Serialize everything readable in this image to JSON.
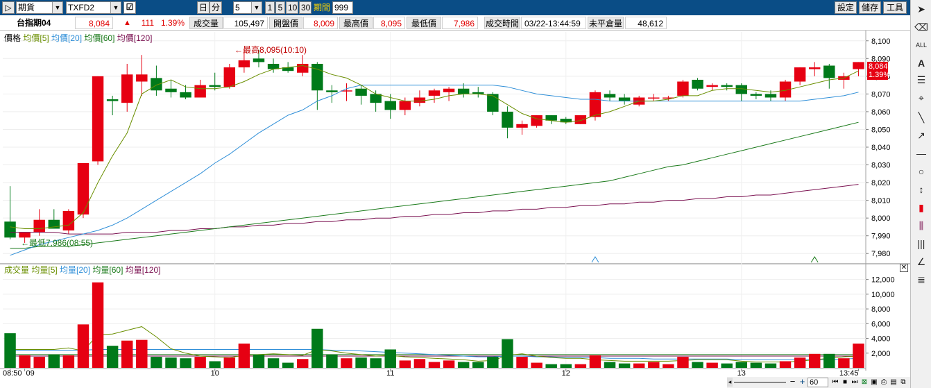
{
  "toolbar": {
    "play": "▷",
    "market": "期貨",
    "symbol": "TXFD2",
    "day_btn": "日",
    "minute_btn": "分",
    "interval": "5",
    "q1": "1",
    "q5": "5",
    "q10": "10",
    "q30": "30",
    "period_label": "期間",
    "period_value": "999",
    "settings": "設定",
    "save": "儲存",
    "tools": "工具"
  },
  "quote": {
    "name": "台指期04",
    "price": "8,084",
    "arrow": "▲",
    "change": "111",
    "pct": "1.39%",
    "vol_label": "成交量",
    "vol": "105,497",
    "open_label": "開盤價",
    "open": "8,009",
    "high_label": "最高價",
    "high": "8,095",
    "low_label": "最低價",
    "low": "7,986",
    "time_label": "成交時間",
    "time": "03/22-13:44:59",
    "oi_label": "未平倉量",
    "oi": "48,612"
  },
  "price_legend": {
    "main": "價格",
    "ma5": "均價[5]",
    "ma20": "均價[20]",
    "ma60": "均價[60]",
    "ma120": "均價[120]"
  },
  "vol_legend": {
    "main": "成交量",
    "ma5": "均量[5]",
    "ma20": "均量[20]",
    "ma60": "均量[60]",
    "ma120": "均量[120]"
  },
  "annotations": {
    "high": "←最高8,095(10:10)",
    "low": "←最低7,986(08:55)"
  },
  "last_tag": {
    "price": "8,084",
    "pct": "1.39%"
  },
  "price_ticks": [
    "8,100",
    "8,090",
    "8,080",
    "8,070",
    "8,060",
    "8,050",
    "8,040",
    "8,030",
    "8,020",
    "8,010",
    "8,000",
    "7,990",
    "7,980"
  ],
  "vol_ticks": [
    "12,000",
    "10,000",
    "8,000",
    "6,000",
    "4,000",
    "2,000"
  ],
  "x_ticks": [
    "08:50",
    "09",
    "10",
    "11",
    "12",
    "13",
    "13:45"
  ],
  "zoom_value": "60",
  "colors": {
    "up": "#e60012",
    "down": "#007a1a",
    "ma5": "#6a8f00",
    "ma20": "#2f8fd8",
    "ma60": "#1a7a1a",
    "ma120": "#7a1050",
    "header": "#0a4d86"
  },
  "chart_data": {
    "type": "candlestick",
    "ylim": [
      7975,
      8105
    ],
    "vol_ylim": [
      0,
      13000
    ],
    "candles": [
      {
        "o": 7998,
        "h": 8018,
        "l": 7988,
        "c": 7989,
        "v": 4700
      },
      {
        "o": 7989,
        "h": 7992,
        "l": 7986,
        "c": 7992,
        "v": 1700
      },
      {
        "o": 7992,
        "h": 8005,
        "l": 7990,
        "c": 7999,
        "v": 1500
      },
      {
        "o": 7999,
        "h": 8005,
        "l": 7994,
        "c": 7994,
        "v": 1800
      },
      {
        "o": 7993,
        "h": 8005,
        "l": 7991,
        "c": 8004,
        "v": 1700
      },
      {
        "o": 8002,
        "h": 8031,
        "l": 8000,
        "c": 8031,
        "v": 5900
      },
      {
        "o": 8032,
        "h": 8080,
        "l": 8030,
        "c": 8080,
        "v": 11600
      },
      {
        "o": 8067,
        "h": 8069,
        "l": 8058,
        "c": 8066,
        "v": 3000
      },
      {
        "o": 8065,
        "h": 8087,
        "l": 8060,
        "c": 8081,
        "v": 3700
      },
      {
        "o": 8077,
        "h": 8092,
        "l": 8069,
        "c": 8081,
        "v": 3800
      },
      {
        "o": 8079,
        "h": 8086,
        "l": 8069,
        "c": 8072,
        "v": 1500
      },
      {
        "o": 8073,
        "h": 8078,
        "l": 8068,
        "c": 8071,
        "v": 1400
      },
      {
        "o": 8071,
        "h": 8075,
        "l": 8067,
        "c": 8068,
        "v": 1300
      },
      {
        "o": 8068,
        "h": 8078,
        "l": 8068,
        "c": 8075,
        "v": 1500
      },
      {
        "o": 8075,
        "h": 8082,
        "l": 8072,
        "c": 8074,
        "v": 900
      },
      {
        "o": 8074,
        "h": 8087,
        "l": 8073,
        "c": 8085,
        "v": 1400
      },
      {
        "o": 8085,
        "h": 8095,
        "l": 8082,
        "c": 8089,
        "v": 3300
      },
      {
        "o": 8090,
        "h": 8095,
        "l": 8085,
        "c": 8088,
        "v": 1800
      },
      {
        "o": 8087,
        "h": 8090,
        "l": 8082,
        "c": 8084,
        "v": 1300
      },
      {
        "o": 8085,
        "h": 8088,
        "l": 8082,
        "c": 8083,
        "v": 700
      },
      {
        "o": 8082,
        "h": 8092,
        "l": 8080,
        "c": 8087,
        "v": 1200
      },
      {
        "o": 8087,
        "h": 8088,
        "l": 8061,
        "c": 8072,
        "v": 5300
      },
      {
        "o": 8072,
        "h": 8075,
        "l": 8065,
        "c": 8071,
        "v": 1800
      },
      {
        "o": 8072,
        "h": 8076,
        "l": 8066,
        "c": 8072,
        "v": 1300
      },
      {
        "o": 8073,
        "h": 8075,
        "l": 8064,
        "c": 8069,
        "v": 1400
      },
      {
        "o": 8070,
        "h": 8072,
        "l": 8060,
        "c": 8065,
        "v": 1300
      },
      {
        "o": 8066,
        "h": 8070,
        "l": 8056,
        "c": 8061,
        "v": 2500
      },
      {
        "o": 8061,
        "h": 8068,
        "l": 8058,
        "c": 8066,
        "v": 1000
      },
      {
        "o": 8065,
        "h": 8072,
        "l": 8063,
        "c": 8068,
        "v": 1200
      },
      {
        "o": 8069,
        "h": 8073,
        "l": 8065,
        "c": 8072,
        "v": 800
      },
      {
        "o": 8071,
        "h": 8074,
        "l": 8066,
        "c": 8073,
        "v": 1000
      },
      {
        "o": 8073,
        "h": 8076,
        "l": 8068,
        "c": 8070,
        "v": 800
      },
      {
        "o": 8071,
        "h": 8074,
        "l": 8068,
        "c": 8070,
        "v": 800
      },
      {
        "o": 8070,
        "h": 8071,
        "l": 8058,
        "c": 8060,
        "v": 1500
      },
      {
        "o": 8060,
        "h": 8063,
        "l": 8045,
        "c": 8051,
        "v": 3900
      },
      {
        "o": 8051,
        "h": 8055,
        "l": 8047,
        "c": 8053,
        "v": 1500
      },
      {
        "o": 8052,
        "h": 8058,
        "l": 8051,
        "c": 8058,
        "v": 700
      },
      {
        "o": 8058,
        "h": 8058,
        "l": 8053,
        "c": 8055,
        "v": 500
      },
      {
        "o": 8056,
        "h": 8057,
        "l": 8053,
        "c": 8054,
        "v": 500
      },
      {
        "o": 8053,
        "h": 8058,
        "l": 8053,
        "c": 8058,
        "v": 500
      },
      {
        "o": 8057,
        "h": 8072,
        "l": 8055,
        "c": 8071,
        "v": 1700
      },
      {
        "o": 8070,
        "h": 8072,
        "l": 8066,
        "c": 8068,
        "v": 800
      },
      {
        "o": 8068,
        "h": 8070,
        "l": 8064,
        "c": 8066,
        "v": 600
      },
      {
        "o": 8064,
        "h": 8069,
        "l": 8063,
        "c": 8068,
        "v": 600
      },
      {
        "o": 8068,
        "h": 8070,
        "l": 8066,
        "c": 8068,
        "v": 800
      },
      {
        "o": 8068,
        "h": 8069,
        "l": 8066,
        "c": 8068,
        "v": 500
      },
      {
        "o": 8069,
        "h": 8078,
        "l": 8068,
        "c": 8077,
        "v": 1500
      },
      {
        "o": 8078,
        "h": 8079,
        "l": 8072,
        "c": 8073,
        "v": 800
      },
      {
        "o": 8074,
        "h": 8076,
        "l": 8072,
        "c": 8075,
        "v": 700
      },
      {
        "o": 8075,
        "h": 8076,
        "l": 8072,
        "c": 8074,
        "v": 600
      },
      {
        "o": 8075,
        "h": 8076,
        "l": 8066,
        "c": 8070,
        "v": 800
      },
      {
        "o": 8070,
        "h": 8071,
        "l": 8067,
        "c": 8069,
        "v": 700
      },
      {
        "o": 8070,
        "h": 8072,
        "l": 8066,
        "c": 8068,
        "v": 600
      },
      {
        "o": 8068,
        "h": 8078,
        "l": 8066,
        "c": 8077,
        "v": 900
      },
      {
        "o": 8077,
        "h": 8085,
        "l": 8075,
        "c": 8085,
        "v": 1400
      },
      {
        "o": 8084,
        "h": 8088,
        "l": 8080,
        "c": 8085,
        "v": 1900
      },
      {
        "o": 8086,
        "h": 8087,
        "l": 8073,
        "c": 8079,
        "v": 1900
      },
      {
        "o": 8078,
        "h": 8082,
        "l": 8073,
        "c": 8080,
        "v": 1300
      },
      {
        "o": 8084,
        "h": 8088,
        "l": 8080,
        "c": 8088,
        "v": 3300
      }
    ],
    "ma5": [
      7995,
      7994,
      7994,
      7995,
      7996,
      8003,
      8020,
      8035,
      8048,
      8070,
      8075,
      8078,
      8074,
      8073,
      8073,
      8074,
      8077,
      8081,
      8084,
      8085,
      8086,
      8084,
      8081,
      8079,
      8075,
      8070,
      8068,
      8066,
      8066,
      8067,
      8069,
      8070,
      8070,
      8069,
      8064,
      8059,
      8056,
      8055,
      8054,
      8055,
      8058,
      8060,
      8063,
      8066,
      8066,
      8067,
      8069,
      8069,
      8072,
      8073,
      8073,
      8072,
      8071,
      8072,
      8074,
      8076,
      8078,
      8079,
      8083
    ],
    "ma20": [
      7979,
      7982,
      7985,
      7987,
      7989,
      7991,
      7993,
      7996,
      8000,
      8005,
      8010,
      8015,
      8020,
      8025,
      8031,
      8036,
      8042,
      8048,
      8053,
      8058,
      8061,
      8066,
      8069,
      8073,
      8075,
      8075,
      8075,
      8075,
      8075,
      8075,
      8075,
      8075,
      8075,
      8075,
      8074,
      8072,
      8070,
      8069,
      8068,
      8067,
      8067,
      8066,
      8066,
      8066,
      8066,
      8066,
      8066,
      8066,
      8066,
      8066,
      8066,
      8066,
      8066,
      8066,
      8066,
      8067,
      8068,
      8069,
      8071
    ],
    "ma60": [
      7983,
      7983,
      7984,
      7984,
      7984,
      7985,
      7986,
      7987,
      7988,
      7989,
      7990,
      7991,
      7992,
      7993,
      7994,
      7995,
      7996,
      7997,
      7998,
      7999,
      8000,
      8001,
      8002,
      8003,
      8004,
      8005,
      8006,
      8007,
      8008,
      8009,
      8010,
      8011,
      8012,
      8013,
      8014,
      8015,
      8016,
      8017,
      8018,
      8019,
      8020,
      8021,
      8023,
      8025,
      8027,
      8029,
      8030,
      8032,
      8034,
      8036,
      8038,
      8040,
      8042,
      8044,
      8046,
      8048,
      8050,
      8052,
      8054
    ],
    "ma120": [
      7992,
      7992,
      7992,
      7992,
      7991,
      7991,
      7991,
      7991,
      7992,
      7992,
      7992,
      7993,
      7993,
      7994,
      7994,
      7995,
      7995,
      7996,
      7996,
      7997,
      7997,
      7998,
      7998,
      7999,
      7999,
      8000,
      8000,
      8001,
      8001,
      8002,
      8002,
      8003,
      8003,
      8004,
      8004,
      8005,
      8005,
      8006,
      8006,
      8007,
      8007,
      8008,
      8008,
      8009,
      8009,
      8010,
      8010,
      8011,
      8011,
      8012,
      8012,
      8013,
      8013,
      8014,
      8015,
      8016,
      8017,
      8018,
      8019
    ],
    "vol_ma5": [
      2500,
      2500,
      2500,
      2500,
      2700,
      2300,
      4500,
      4600,
      5100,
      5600,
      4200,
      2600,
      2000,
      1600,
      1500,
      1400,
      1700,
      1800,
      1900,
      1800,
      1700,
      2500,
      2300,
      2000,
      1800,
      1600,
      1700,
      1500,
      1400,
      1300,
      1200,
      1100,
      900,
      1000,
      1700,
      1900,
      1600,
      1400,
      1300,
      1300,
      1100,
      1000,
      900,
      900,
      900,
      900,
      1000,
      1100,
      1100,
      1100,
      900,
      800,
      800,
      800,
      900,
      1100,
      1300,
      1500,
      1600
    ],
    "vol_ma20": [
      2400,
      2400,
      2400,
      2400,
      2400,
      2400,
      2500,
      2500,
      2500,
      2500,
      2500,
      2500,
      2500,
      2500,
      2500,
      2500,
      2500,
      2500,
      2500,
      2500,
      2500,
      2500,
      2400,
      2400,
      2300,
      2200,
      2100,
      2000,
      1900,
      1800,
      1700,
      1600,
      1500,
      1500,
      1600,
      1600,
      1500,
      1500,
      1400,
      1400,
      1400,
      1300,
      1300,
      1300,
      1200,
      1200,
      1200,
      1200,
      1200,
      1200,
      1100,
      1100,
      1100,
      1100,
      1100,
      1100,
      1100,
      1200,
      1300
    ],
    "vol_ma60": [
      1800,
      1800,
      1800,
      1800,
      1800,
      1800,
      1800,
      1800,
      1800,
      1800,
      1800,
      1800,
      1800,
      1800,
      1800,
      1800,
      1800,
      1800,
      1800,
      1800,
      1800,
      1800,
      1800,
      1800,
      1800,
      1800,
      1800,
      1800,
      1800,
      1800,
      1800,
      1800,
      1800,
      1800,
      1800,
      1800,
      1800,
      1800,
      1800,
      1800,
      1800,
      1800,
      1800,
      1800,
      1800,
      1800,
      1800,
      1800,
      1800,
      1800,
      1800,
      1800,
      1800,
      1800,
      1800,
      1800,
      1800,
      1800,
      1800
    ],
    "vol_ma120": [
      1600,
      1600,
      1600,
      1600,
      1600,
      1600,
      1600,
      1600,
      1600,
      1600,
      1600,
      1600,
      1600,
      1600,
      1600,
      1600,
      1600,
      1600,
      1600,
      1600,
      1600,
      1600,
      1600,
      1600,
      1600,
      1600,
      1600,
      1600,
      1600,
      1600,
      1600,
      1600,
      1600,
      1600,
      1600,
      1600,
      1600,
      1600,
      1600,
      1600,
      1600,
      1600,
      1600,
      1600,
      1600,
      1600,
      1600,
      1600,
      1600,
      1600,
      1600,
      1600,
      1600,
      1600,
      1600,
      1600,
      1600,
      1600,
      1600
    ]
  }
}
